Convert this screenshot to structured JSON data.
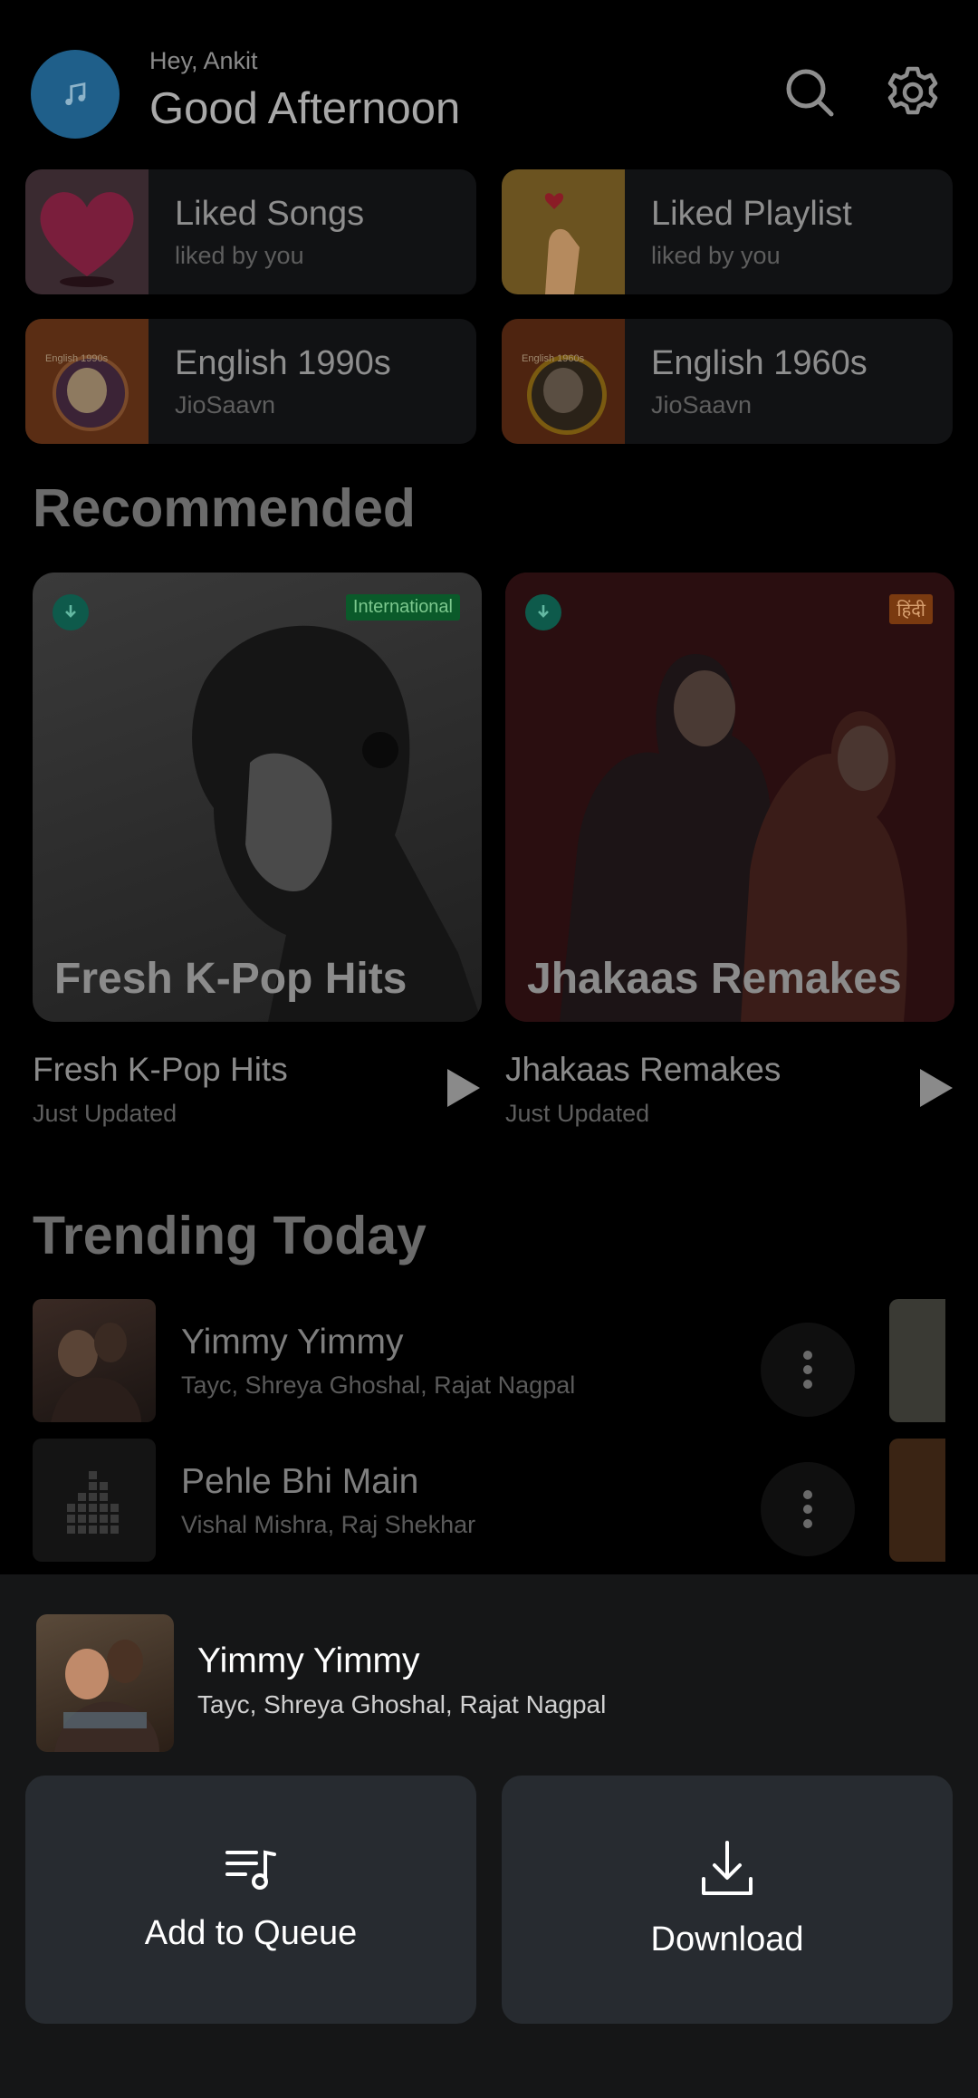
{
  "header": {
    "greeting_small": "Hey, Ankit",
    "greeting_big": "Good Afternoon",
    "avatar_icon": "music-note-icon",
    "search_icon": "search-icon",
    "settings_icon": "gear-icon"
  },
  "quick_tiles": [
    {
      "title": "Liked Songs",
      "subtitle": "liked by you",
      "art_label": ""
    },
    {
      "title": "Liked Playlist",
      "subtitle": "liked by you",
      "art_label": ""
    },
    {
      "title": "English 1990s",
      "subtitle": "JioSaavn",
      "art_label": "English 1990s"
    },
    {
      "title": "English 1960s",
      "subtitle": "JioSaavn",
      "art_label": "English 1960s"
    }
  ],
  "recommended": {
    "title": "Recommended",
    "cards": [
      {
        "overlay": "Fresh K-Pop Hits",
        "badge": "International",
        "title": "Fresh K-Pop Hits",
        "subtitle": "Just Updated"
      },
      {
        "overlay": "Jhakaas Remakes",
        "badge": "हिंदी",
        "title": "Jhakaas Remakes",
        "subtitle": "Just Updated"
      }
    ]
  },
  "trending": {
    "title": "Trending Today",
    "items": [
      {
        "title": "Yimmy Yimmy",
        "subtitle": "Tayc, Shreya Ghoshal, Rajat Nagpal"
      },
      {
        "title": "Pehle Bhi Main",
        "subtitle": "Vishal Mishra, Raj Shekhar"
      }
    ]
  },
  "sheet": {
    "song_title": "Yimmy Yimmy",
    "song_artists": "Tayc, Shreya Ghoshal, Rajat Nagpal",
    "add_to_queue_label": "Add to Queue",
    "download_label": "Download"
  },
  "colors": {
    "background": "#000000",
    "sheet_bg": "#151617",
    "action_bg": "#272b30",
    "accent_green": "#0e5a4b"
  }
}
